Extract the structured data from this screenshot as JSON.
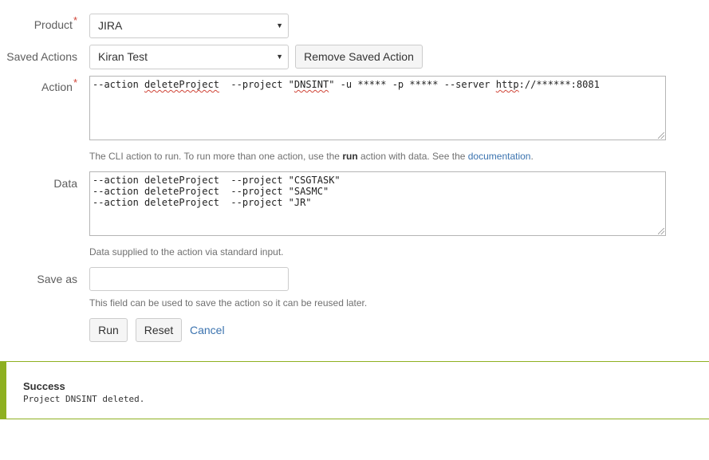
{
  "form": {
    "product": {
      "label": "Product",
      "required_mark": "*",
      "selected": "JIRA"
    },
    "saved_actions": {
      "label": "Saved Actions",
      "selected": "Kiran Test",
      "remove_button": "Remove Saved Action"
    },
    "action": {
      "label": "Action",
      "required_mark": "*",
      "value_parts": [
        "--action ",
        "deleteProject",
        "  --project \"",
        "DNSINT",
        "\" -u ***** -p ***** --server ",
        "http",
        "://******:8081"
      ],
      "help": {
        "prefix": "The CLI action to run. To run more than one action, use the ",
        "bold": "run",
        "middle": " action with data. See the ",
        "link": "documentation",
        "suffix": "."
      }
    },
    "data": {
      "label": "Data",
      "value": "--action deleteProject  --project \"CSGTASK\"\n--action deleteProject  --project \"SASMC\"\n--action deleteProject  --project \"JR\"",
      "help": "Data supplied to the action via standard input."
    },
    "save_as": {
      "label": "Save as",
      "value": "",
      "help": "This field can be used to save the action so it can be reused later."
    },
    "buttons": {
      "run": "Run",
      "reset": "Reset",
      "cancel": "Cancel"
    }
  },
  "message": {
    "title": "Success",
    "body": "Project DNSINT deleted."
  },
  "icons": {
    "select_caret": "chevron-down-icon"
  },
  "colors": {
    "required": "#d04437",
    "link": "#3b73af",
    "success": "#8eb021"
  }
}
